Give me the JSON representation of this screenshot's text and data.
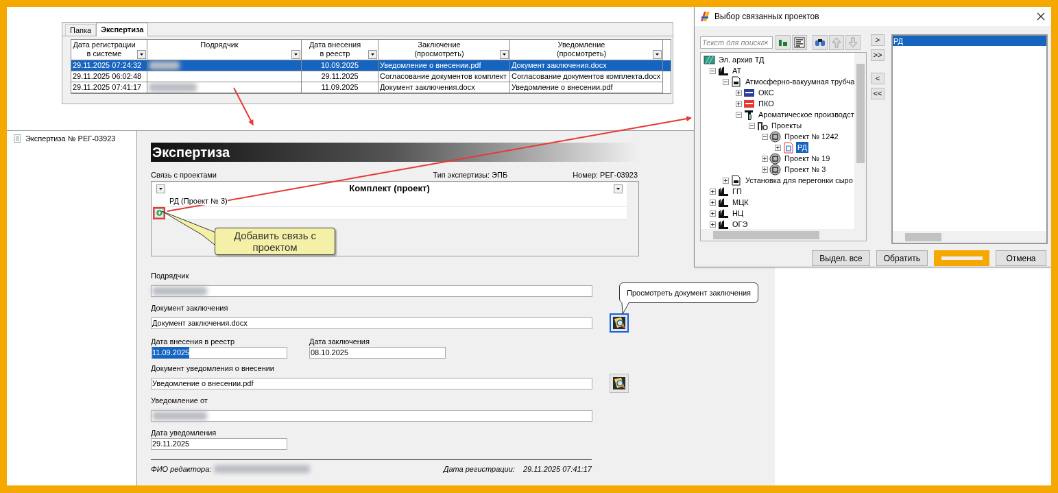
{
  "grid_panel": {
    "tabs": [
      {
        "label": "Папка",
        "selected": false
      },
      {
        "label": "Экспертиза",
        "selected": true
      }
    ],
    "columns": [
      "Дата регистрации\nв системе",
      "Подрядчик",
      "Дата внесения\nв реестр",
      "Заключение\n(просмотреть)",
      "Уведомление\n(просмотреть)"
    ],
    "rows": [
      {
        "selected": true,
        "registered": "29.11.2025 07:24:32",
        "contractor_redacted": true,
        "registry_date": "10.09.2025",
        "conclusion": "Уведомление о внесении.pdf",
        "notification": "Документ заключения.docx"
      },
      {
        "selected": false,
        "registered": "29.11.2025 06:02:48",
        "contractor_redacted": false,
        "registry_date": "29.11.2025",
        "conclusion": "Согласование документов комплект",
        "notification": "Согласование документов комплекта.docx"
      },
      {
        "selected": false,
        "registered": "29.11.2025 07:41:17",
        "contractor_redacted": true,
        "registry_date": "11.09.2025",
        "conclusion": "Документ заключения.docx",
        "notification": "Уведомление о внесении.pdf"
      }
    ]
  },
  "side_tree": {
    "items": [
      {
        "label": "Экспертиза № РЕГ-03923"
      }
    ]
  },
  "form": {
    "title": "Экспертиза",
    "links_label": "Связь с проектами",
    "type_text": "Тип экспертизы: ЭПБ",
    "number_text": "Номер: РЕГ-03923",
    "links_table": {
      "header": "Комплект (проект)",
      "rows": [
        "РД (Проект № 3)"
      ]
    },
    "callout": "Добавить связь с проектом",
    "tooltip": "Просмотреть документ заключения",
    "fields": [
      {
        "kind": "text",
        "label": "Подрядчик",
        "redacted": true
      },
      {
        "kind": "text",
        "label": "Документ заключения",
        "value": "Документ заключения.docx",
        "view_button": true,
        "focused": true
      },
      {
        "kind": "pair",
        "items": [
          {
            "label": "Дата внесения в реестр",
            "value": "11.09.2025",
            "highlighted": true
          },
          {
            "label": "Дата заключения",
            "value": "08.10.2025",
            "highlighted": false
          }
        ]
      },
      {
        "kind": "text",
        "label": "Документ уведомления о внесении",
        "value": "Уведомление о внесении.pdf",
        "view_button": true,
        "focused": false
      },
      {
        "kind": "text",
        "label": "Уведомление от",
        "redacted": true
      },
      {
        "kind": "short",
        "label": "Дата уведомления",
        "value": "29.11.2025"
      }
    ],
    "footer": {
      "editor_label": "ФИО редактора:",
      "editor_redacted": true,
      "date_label": "Дата регистрации:",
      "date_value": "29.11.2025 07:41:17"
    }
  },
  "dialog": {
    "title": "Выбор связанных проектов",
    "search": {
      "placeholder": "Текст для поиска",
      "clear": "×"
    },
    "tree": [
      {
        "label": "Эл. архив ТД",
        "kind": "archive",
        "selected": false,
        "children": [
          {
            "label": "АТ",
            "kind": "factory",
            "expanded": true,
            "selected": false,
            "children": [
              {
                "label": "Атмосферно-вакуумная трубча",
                "kind": "doc",
                "expanded": true,
                "selected": false,
                "children": [
                  {
                    "label": "ОКС",
                    "kind": "oks",
                    "expanded": false,
                    "selected": false
                  },
                  {
                    "label": "ПКО",
                    "kind": "pko",
                    "expanded": false,
                    "selected": false
                  },
                  {
                    "label": "Ароматическое производст",
                    "kind": "plant",
                    "expanded": true,
                    "selected": false,
                    "children": [
                      {
                        "label": "Проекты",
                        "kind": "projects",
                        "expanded": true,
                        "selected": false,
                        "children": [
                          {
                            "label": "Проект № 1242",
                            "kind": "project",
                            "expanded": true,
                            "selected": false,
                            "children": [
                              {
                                "label": "РД",
                                "kind": "rd",
                                "expanded": false,
                                "selected": true
                              }
                            ]
                          },
                          {
                            "label": "Проект № 19",
                            "kind": "project",
                            "expanded": false,
                            "selected": false
                          },
                          {
                            "label": "Проект № 3",
                            "kind": "project",
                            "expanded": false,
                            "selected": false
                          }
                        ]
                      }
                    ]
                  }
                ]
              },
              {
                "label": "Установка для перегонки сыро",
                "kind": "doc",
                "expanded": false,
                "selected": false
              }
            ]
          },
          {
            "label": "ГП",
            "kind": "factory",
            "expanded": false,
            "selected": false
          },
          {
            "label": "МЦК",
            "kind": "factory",
            "expanded": false,
            "selected": false
          },
          {
            "label": "НЦ",
            "kind": "factory",
            "expanded": false,
            "selected": false
          },
          {
            "label": "ОГЭ",
            "kind": "factory",
            "expanded": false,
            "selected": false
          }
        ]
      }
    ],
    "move_buttons": [
      ">",
      ">>",
      "<",
      "<<"
    ],
    "selected_list": [
      {
        "label": "РД",
        "selected": true
      }
    ],
    "buttons": [
      {
        "label": "Выдел. все",
        "highlighted": false
      },
      {
        "label": "Обратить",
        "highlighted": false
      },
      {
        "highlighted": true
      },
      {
        "label": "Отмена",
        "highlighted": false
      }
    ]
  }
}
